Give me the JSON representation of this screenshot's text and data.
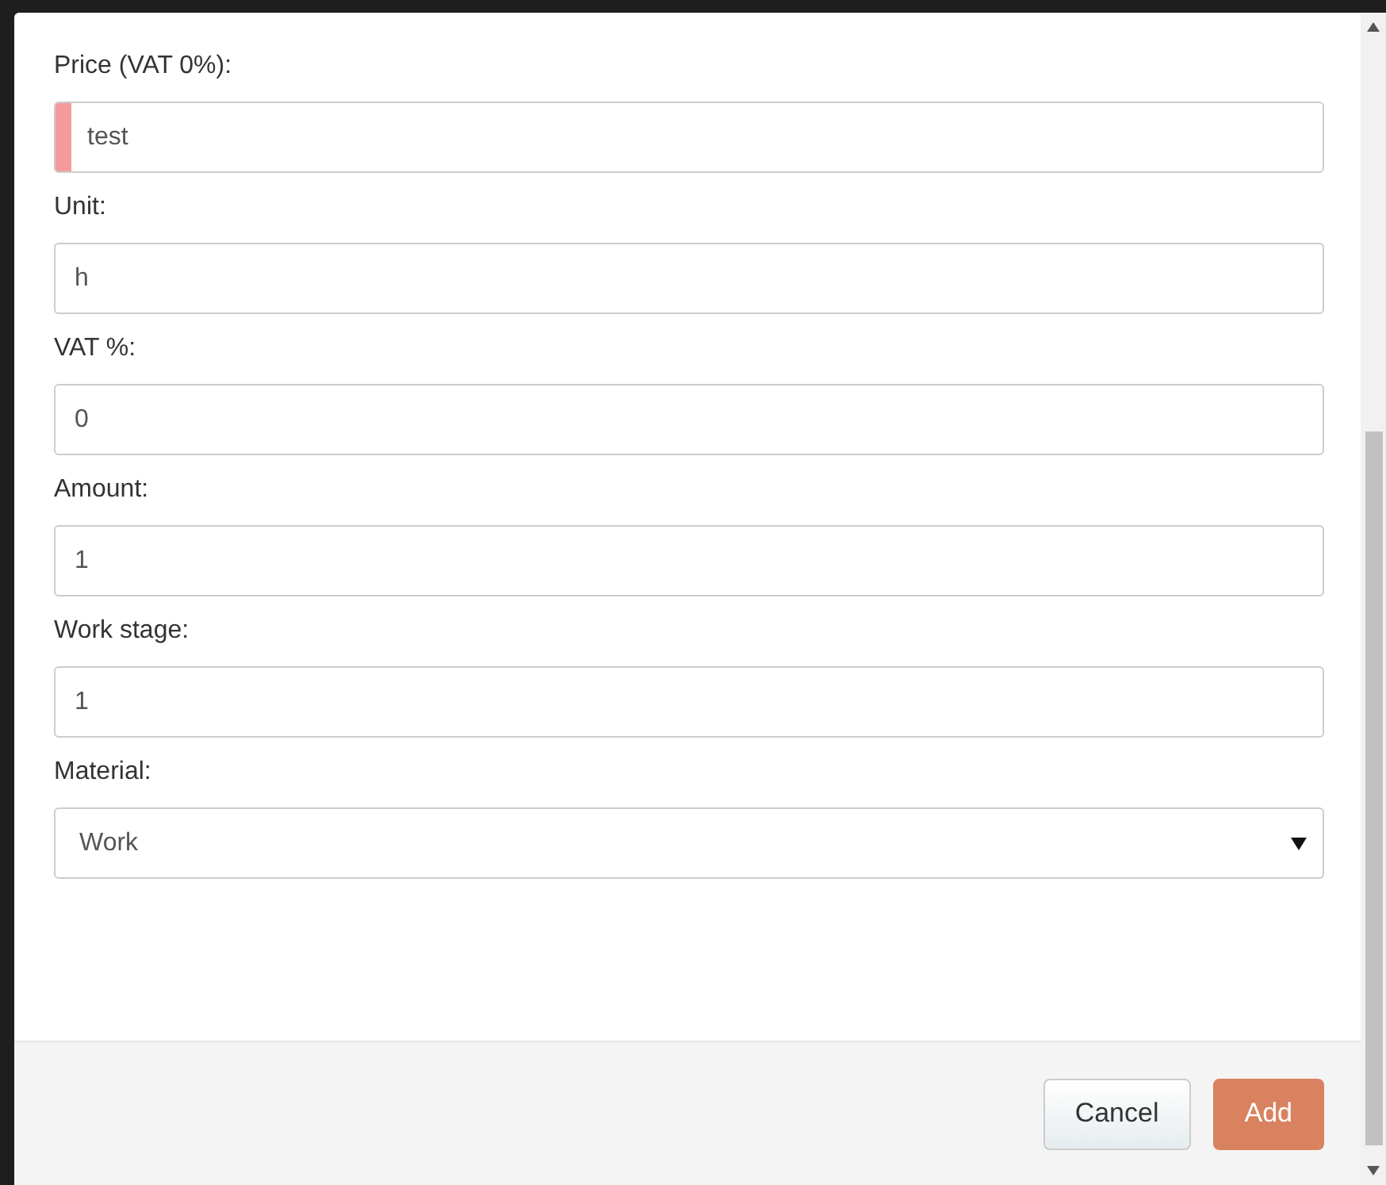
{
  "form": {
    "fields": [
      {
        "label": "Price (VAT 0%):",
        "kind": "text",
        "value": "test",
        "invalid": true
      },
      {
        "label": "Unit:",
        "kind": "text",
        "value": "h",
        "invalid": false
      },
      {
        "label": "VAT %:",
        "kind": "text",
        "value": "0",
        "invalid": false
      },
      {
        "label": "Amount:",
        "kind": "text",
        "value": "1",
        "invalid": false
      },
      {
        "label": "Work stage:",
        "kind": "text",
        "value": "1",
        "invalid": false
      },
      {
        "label": "Material:",
        "kind": "select",
        "value": "Work"
      }
    ]
  },
  "footer": {
    "buttons": [
      {
        "label": "Cancel",
        "kind": "default"
      },
      {
        "label": "Add",
        "kind": "primary"
      }
    ]
  }
}
